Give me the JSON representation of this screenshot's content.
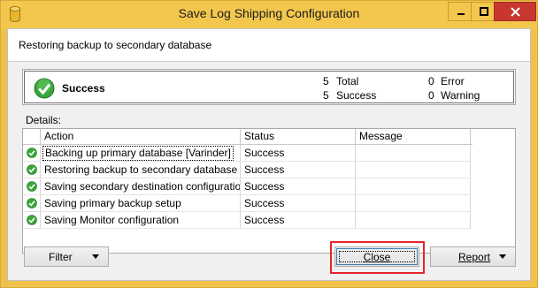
{
  "window": {
    "title": "Save Log Shipping Configuration",
    "controls": {
      "minimize": "—",
      "maximize": "□",
      "close": "✕"
    }
  },
  "header": {
    "subtitle": "Restoring backup to secondary database"
  },
  "summary": {
    "status": "Success",
    "total_count": "5",
    "total_label": "Total",
    "success_count": "5",
    "success_label": "Success",
    "error_count": "0",
    "error_label": "Error",
    "warning_count": "0",
    "warning_label": "Warning"
  },
  "details": {
    "label": "Details:",
    "columns": [
      "Action",
      "Status",
      "Message"
    ],
    "rows": [
      {
        "action": "Backing up primary database [Varinder]",
        "status": "Success",
        "message": ""
      },
      {
        "action": "Restoring backup to secondary database ...",
        "status": "Success",
        "message": ""
      },
      {
        "action": "Saving secondary destination configuratio...",
        "status": "Success",
        "message": ""
      },
      {
        "action": "Saving primary backup setup",
        "status": "Success",
        "message": ""
      },
      {
        "action": "Saving Monitor configuration",
        "status": "Success",
        "message": ""
      }
    ]
  },
  "buttons": {
    "filter": "Filter",
    "close": "Close",
    "report": "Report"
  },
  "colors": {
    "title_bar": "#f3c74d",
    "close_control": "#c7372f",
    "success_green": "#3aa63a",
    "highlight_red": "#e3262b"
  }
}
